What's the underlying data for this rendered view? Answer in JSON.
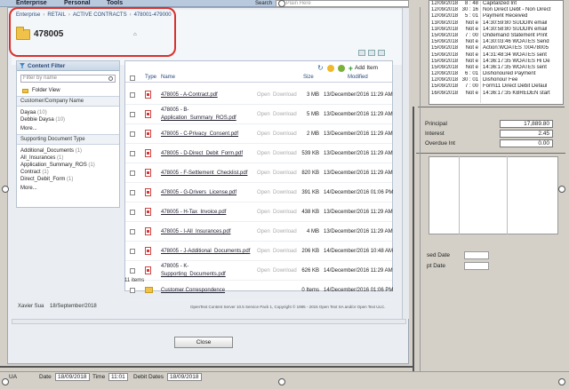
{
  "bg_app": {
    "menu": [
      "Enterprise",
      "Personal",
      "Tools"
    ],
    "search_label": "Search",
    "search_placeholder": "In Plain Here",
    "log_rows": [
      {
        "date": "12/09/2018",
        "time": "8 : 48",
        "text": "Capitalized Int"
      },
      {
        "date": "12/09/2018",
        "time": "30 : 16",
        "text": "Non Direct Debt - Non Direct"
      },
      {
        "date": "12/09/2018",
        "time": "5 : 01",
        "text": "Payment Received"
      },
      {
        "date": "13/09/2018",
        "time": "Not e",
        "text": "14:30:59:80 SUDDIN email"
      },
      {
        "date": "13/09/2018",
        "time": "Not e",
        "text": "14:30:58:80 SUDDIN email"
      },
      {
        "date": "15/09/2018",
        "time": "7 : 00",
        "text": "Ondemand Statement Print"
      },
      {
        "date": "15/09/2018",
        "time": "Not e",
        "text": "14:30:03:46 WOATES Send"
      },
      {
        "date": "15/09/2018",
        "time": "Not e",
        "text": "Action:WOATES :00478005"
      },
      {
        "date": "15/09/2018",
        "time": "Not e",
        "text": "14:31:48:34 WOATES sent"
      },
      {
        "date": "15/09/2018",
        "time": "Not e",
        "text": "14:36:17:35 WOATES Hi De"
      },
      {
        "date": "15/09/2018",
        "time": "Not e",
        "text": "14:36:17:35 WOATES sent"
      },
      {
        "date": "12/09/2018",
        "time": "6 : 01",
        "text": "Dishonoured Payment"
      },
      {
        "date": "12/09/2018",
        "time": "30 : 01",
        "text": "Dishonour Fee"
      },
      {
        "date": "15/09/2018",
        "time": "7 : 00",
        "text": "Form11 Direct Debit Defaul"
      },
      {
        "date": "16/09/2018",
        "time": "Not e",
        "text": "14:36:17:35 KBREDEN start"
      },
      {
        "date": "",
        "time": "",
        "text": ""
      }
    ],
    "financials": [
      {
        "label": "Principal",
        "value": "17,889.80"
      },
      {
        "label": "Interest",
        "value": "2.45"
      },
      {
        "label": "Overdue Int",
        "value": "0.00"
      }
    ],
    "date_labels": [
      "sed Date",
      "pt Date"
    ],
    "status": {
      "left": "UA",
      "date_label": "Date",
      "date_value": "18/09/2018",
      "time_label": "Time",
      "time_value": "11:01",
      "debit_label": "Debit Dates",
      "debit_value": "18/09/2018"
    }
  },
  "dialog": {
    "breadcrumb": [
      "Enterprise",
      "RETAIL",
      "ACTIVE CONTRACTS",
      "478001-479000"
    ],
    "folder_title": "478005",
    "filter": {
      "title": "Content Filter",
      "placeholder": "Filter by name",
      "folder_view": "Folder View",
      "company_title": "Customer/Company Name",
      "company_items": [
        {
          "name": "Dayaa",
          "count": "(10)"
        },
        {
          "name": "Debbie Daysa",
          "count": "(10)"
        }
      ],
      "more": "More...",
      "doctype_title": "Supporting Document Type",
      "doctype_items": [
        {
          "name": "Additional_Documents",
          "count": "(1)"
        },
        {
          "name": "All_Insurances",
          "count": "(1)"
        },
        {
          "name": "Application_Summary_ROS",
          "count": "(1)"
        },
        {
          "name": "Contract",
          "count": "(1)"
        },
        {
          "name": "Direct_Debit_Form",
          "count": "(1)"
        }
      ]
    },
    "toolbar": {
      "add_item": "Add Item"
    },
    "columns": {
      "type": "Type",
      "name": "Name",
      "size": "Size",
      "modified": "Modified"
    },
    "actions": {
      "open": "Open",
      "download": "Download"
    },
    "files": [
      {
        "name": "478005 - A-Contract.pdf",
        "name2": "",
        "size": "3 MB",
        "modified": "13/December/2016 11:29 AM",
        "type": "pdf"
      },
      {
        "name": "478005 - B-",
        "name2": "Application_Summary_ROS.pdf",
        "size": "5 MB",
        "modified": "13/December/2016 11:29 AM",
        "type": "pdf"
      },
      {
        "name": "478005 - C-Privacy_Consent.pdf",
        "name2": "",
        "size": "2 MB",
        "modified": "13/December/2016 11:29 AM",
        "type": "pdf"
      },
      {
        "name": "478005 - D-Direct_Debit_Form.pdf",
        "name2": "",
        "size": "539 KB",
        "modified": "13/December/2016 11:29 AM",
        "type": "pdf"
      },
      {
        "name": "478005 - F-Settlement_Checklist.pdf",
        "name2": "",
        "size": "820 KB",
        "modified": "13/December/2016 11:29 AM",
        "type": "pdf"
      },
      {
        "name": "478005 - G-Drivers_License.pdf",
        "name2": "",
        "size": "391 KB",
        "modified": "14/December/2016 01:06 PM",
        "type": "pdf"
      },
      {
        "name": "478005 - H-Tax_Invoice.pdf",
        "name2": "",
        "size": "438 KB",
        "modified": "13/December/2016 11:29 AM",
        "type": "pdf"
      },
      {
        "name": "478005 - I-All_Insurances.pdf",
        "name2": "",
        "size": "4 MB",
        "modified": "13/December/2016 11:29 AM",
        "type": "pdf"
      },
      {
        "name": "478005 - J-Additional_Documents.pdf",
        "name2": "",
        "size": "206 KB",
        "modified": "14/December/2016 10:48 AM",
        "type": "pdf"
      },
      {
        "name": "478005 - K-",
        "name2": "Supporting_Documents.pdf",
        "size": "626 KB",
        "modified": "14/December/2016 11:29 AM",
        "type": "pdf"
      },
      {
        "name": "Customer Correspondence",
        "name2": "",
        "size": "0 Items",
        "modified": "14/December/2016 01:06 PM",
        "type": "folder"
      }
    ],
    "item_count": "11 items",
    "footer_user": "Xavier Sua",
    "footer_date": "18/September/2018",
    "copyright": "OpenText Content Server 10.5 Service Pack 1, Copyright © 1995 - 2015 Open Text SA and/or Open Text ULC.",
    "close_label": "Close"
  }
}
